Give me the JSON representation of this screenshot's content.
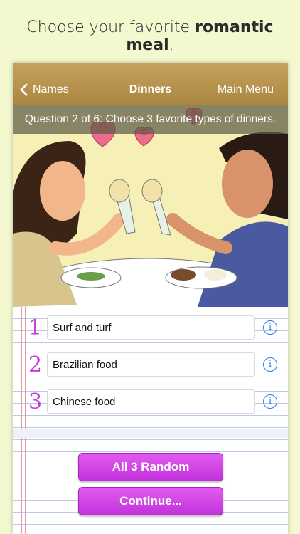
{
  "headline": {
    "prefix": "Choose your favorite ",
    "bold": "romantic meal",
    "suffix": "."
  },
  "nav": {
    "back_label": "Names",
    "title": "Dinners",
    "menu_label": "Main Menu"
  },
  "question": "Question 2 of 6: Choose 3 favorite types of dinners.",
  "choices": [
    {
      "number": "1",
      "value": "Surf and turf"
    },
    {
      "number": "2",
      "value": "Brazilian food"
    },
    {
      "number": "3",
      "value": "Chinese food"
    }
  ],
  "buttons": {
    "random_label": "All 3 Random",
    "continue_label": "Continue..."
  },
  "colors": {
    "nav": "#b8944f",
    "accent": "#d447e6",
    "info": "#2b7de9"
  }
}
